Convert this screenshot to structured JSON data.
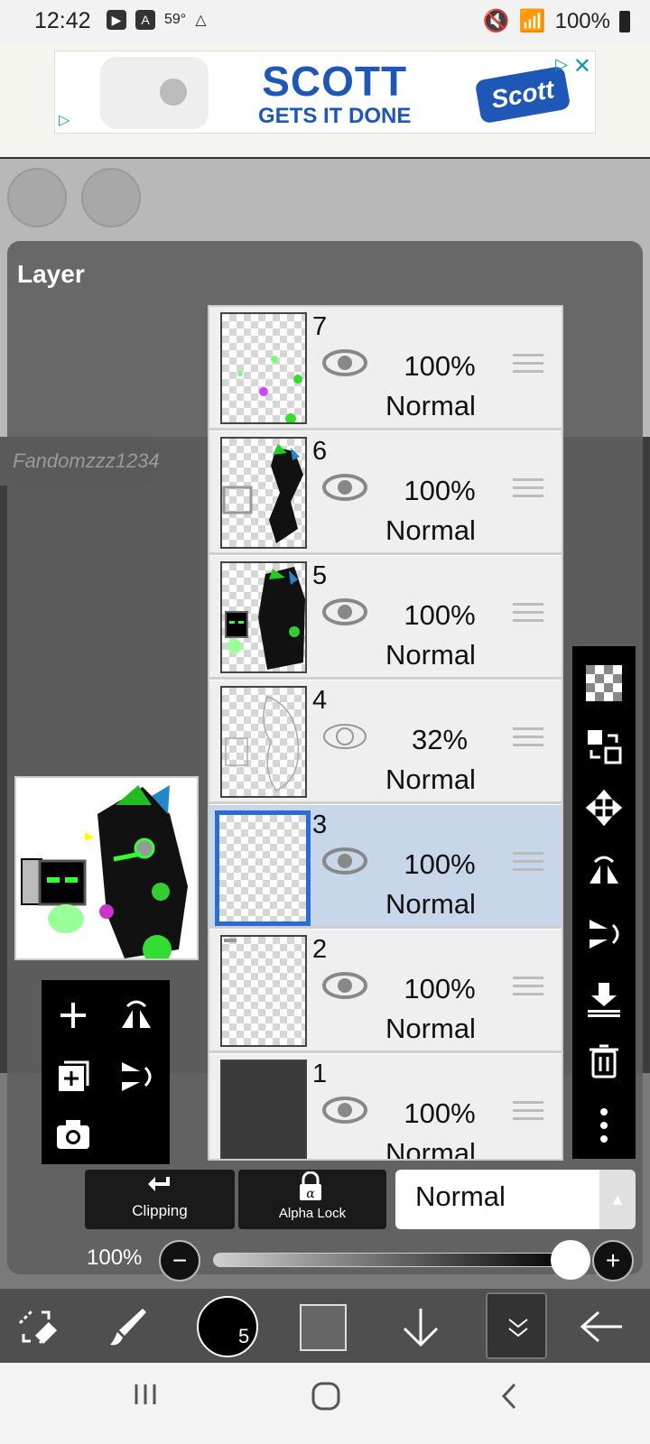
{
  "status": {
    "time": "12:42",
    "temp": "59°",
    "battery": "100%"
  },
  "ad": {
    "brand_line1": "SCOTT",
    "brand_line2": "GETS IT DONE",
    "logo": "Scott"
  },
  "panel": {
    "title": "Layer",
    "signature": "Fandomzzz1234"
  },
  "layers": [
    {
      "number": "7",
      "opacity": "100%",
      "mode": "Normal",
      "visible": true,
      "selected": false
    },
    {
      "number": "6",
      "opacity": "100%",
      "mode": "Normal",
      "visible": true,
      "selected": false
    },
    {
      "number": "5",
      "opacity": "100%",
      "mode": "Normal",
      "visible": true,
      "selected": false
    },
    {
      "number": "4",
      "opacity": "32%",
      "mode": "Normal",
      "visible": true,
      "selected": false
    },
    {
      "number": "3",
      "opacity": "100%",
      "mode": "Normal",
      "visible": true,
      "selected": true
    },
    {
      "number": "2",
      "opacity": "100%",
      "mode": "Normal",
      "visible": true,
      "selected": false
    },
    {
      "number": "1",
      "opacity": "100%",
      "mode": "Normal",
      "visible": true,
      "selected": false
    }
  ],
  "controls": {
    "clipping_label": "Clipping",
    "alpha_lock_label": "Alpha Lock",
    "blend_mode": "Normal",
    "opacity_value": "100%",
    "minus_glyph": "−",
    "plus_glyph": "+"
  },
  "brush": {
    "size": "5"
  },
  "colors": {
    "accent_selected": "#2b6bd6",
    "selected_row": "#c8d6ea"
  },
  "icons": {
    "right_toolbar": [
      "checker-icon",
      "transfer-icon",
      "move-icon",
      "flip-horizontal-icon",
      "flip-vertical-icon",
      "merge-down-icon",
      "trash-icon",
      "more-icon"
    ],
    "left_toolbar": [
      "add-layer-icon",
      "flip-layer-icon",
      "duplicate-layer-icon",
      "rotate-layer-icon",
      "camera-icon"
    ]
  }
}
